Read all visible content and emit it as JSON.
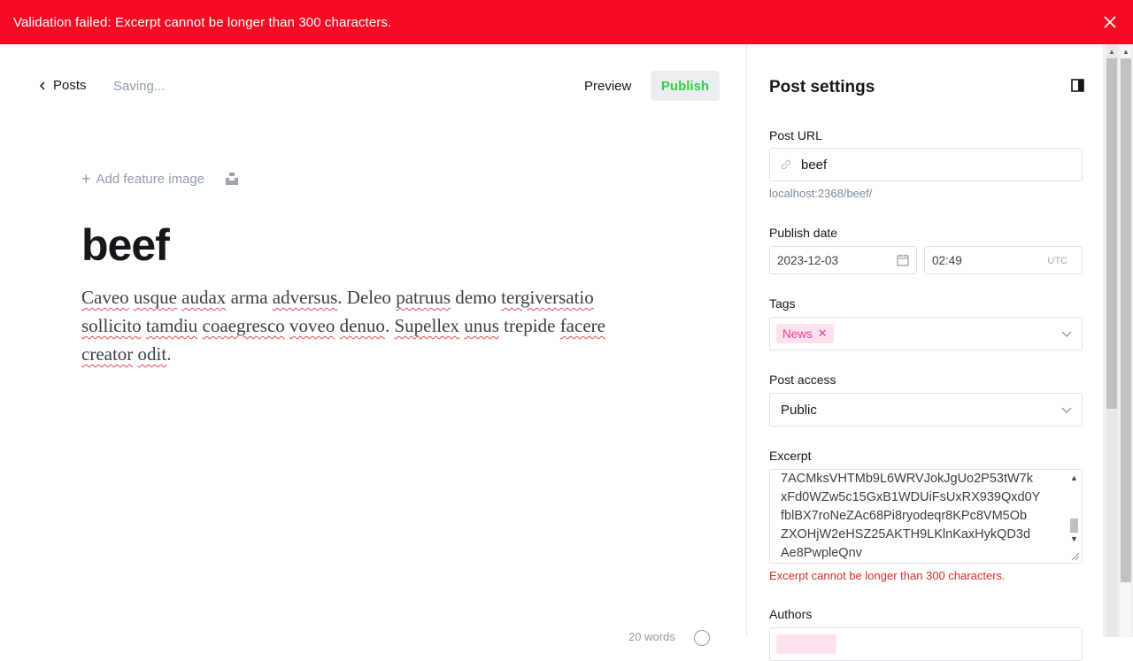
{
  "banner": {
    "message": "Validation failed: Excerpt cannot be longer than 300 characters."
  },
  "editor": {
    "back_label": "Posts",
    "status": "Saving...",
    "preview_label": "Preview",
    "publish_label": "Publish",
    "add_feature_label": "Add feature image",
    "title": "beef",
    "body_words": [
      {
        "t": "Caveo",
        "sp": true
      },
      {
        "t": " ",
        "sp": false
      },
      {
        "t": "usque",
        "sp": true
      },
      {
        "t": " ",
        "sp": false
      },
      {
        "t": "audax",
        "sp": true
      },
      {
        "t": " arma ",
        "sp": false
      },
      {
        "t": "adversus",
        "sp": true
      },
      {
        "t": ". Deleo ",
        "sp": false
      },
      {
        "t": "patruus",
        "sp": true
      },
      {
        "t": " demo ",
        "sp": false
      },
      {
        "t": "tergiversatio",
        "sp": true
      },
      {
        "t": " ",
        "sp": false
      },
      {
        "t": "sollicito",
        "sp": true
      },
      {
        "t": " ",
        "sp": false
      },
      {
        "t": "tamdiu",
        "sp": true
      },
      {
        "t": " ",
        "sp": false
      },
      {
        "t": "coaegresco",
        "sp": true
      },
      {
        "t": " ",
        "sp": false
      },
      {
        "t": "voveo",
        "sp": true
      },
      {
        "t": " ",
        "sp": false
      },
      {
        "t": "denuo",
        "sp": true
      },
      {
        "t": ". ",
        "sp": false
      },
      {
        "t": "Supellex",
        "sp": true
      },
      {
        "t": " ",
        "sp": false
      },
      {
        "t": "unus",
        "sp": true
      },
      {
        "t": " trepide ",
        "sp": false
      },
      {
        "t": "facere",
        "sp": true
      },
      {
        "t": " ",
        "sp": false
      },
      {
        "t": "creator",
        "sp": true
      },
      {
        "t": " ",
        "sp": false
      },
      {
        "t": "odit",
        "sp": true
      },
      {
        "t": ".",
        "sp": false
      }
    ],
    "word_count": "20 words"
  },
  "settings": {
    "title": "Post settings",
    "url_label": "Post URL",
    "url_value": "beef",
    "url_hint": "localhost:2368/beef/",
    "publish_date_label": "Publish date",
    "date_value": "2023-12-03",
    "time_value": "02:49",
    "timezone": "UTC",
    "tags_label": "Tags",
    "tag": "News",
    "access_label": "Post access",
    "access_value": "Public",
    "excerpt_label": "Excerpt",
    "excerpt_lines": [
      "7ACMksVHTMb9L6WRVJokJgUo2P53tW7k",
      "xFd0WZw5c15GxB1WDUiFsUxRX939Qxd0Y",
      "fblBX7roNeZAc68Pi8ryodeqr8KPc8VM5Ob",
      "ZXOHjW2eHSZ25AKTH9LKlnKaxHykQD3d",
      "Ae8PwpleQnv"
    ],
    "excerpt_error": "Excerpt cannot be longer than 300 characters.",
    "authors_label": "Authors"
  },
  "colors": {
    "banner": "#f50b23",
    "publish_text": "#30cf43",
    "tag_bg": "#fde1ef",
    "tag_text": "#e63e99",
    "error": "#e02a2a"
  }
}
